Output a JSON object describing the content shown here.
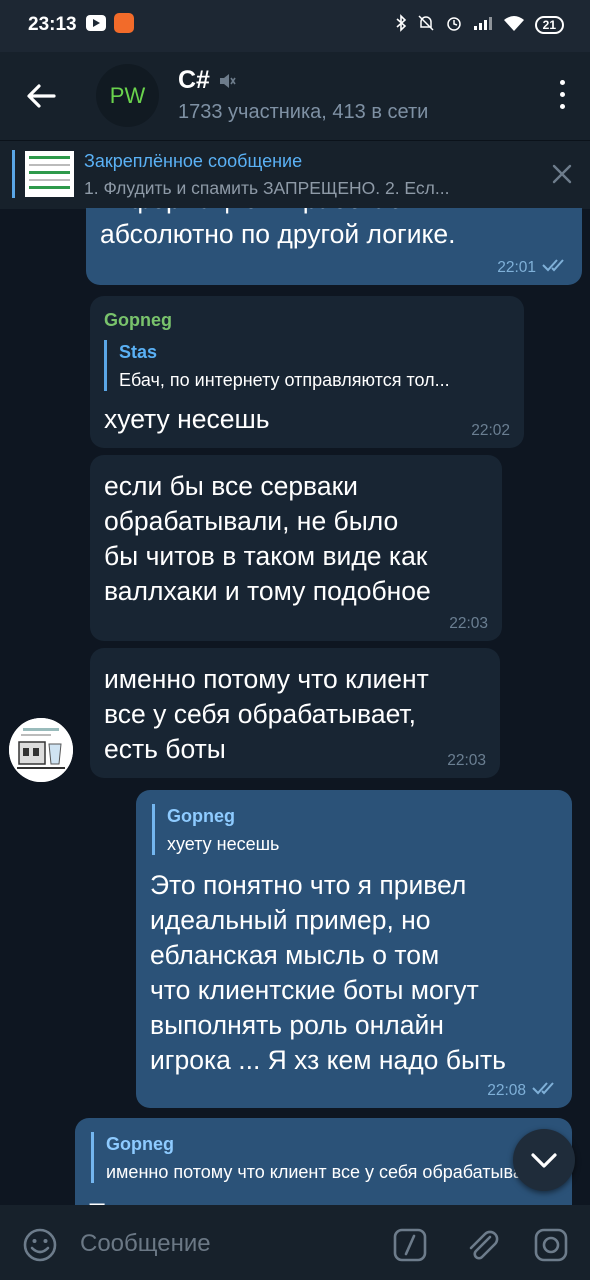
{
  "status_bar": {
    "time": "23:13",
    "battery": "21"
  },
  "header": {
    "avatar_text": "PW",
    "title": "C#",
    "subtitle": "1733 участника, 413 в сети"
  },
  "pinned": {
    "title": "Закреплённое сообщение",
    "text": "1. Флудить и спамить ЗАПРЕЩЕНО.  2. Есл..."
  },
  "messages": [
    {
      "text": "информацией и работает\nабсолютно по другой логике.",
      "time": "22:01"
    },
    {
      "sender": "Gopneg",
      "reply_name": "Stas",
      "reply_text": "Ебач, по интернету отправляются тол...",
      "text": "хуету несешь",
      "time": "22:02"
    },
    {
      "text": "если бы все серваки\nобрабатывали, не было\nбы читов в таком виде как\nваллхаки и тому подобное",
      "time": "22:03"
    },
    {
      "text": "именно потому что клиент\nвсе у себя обрабатывает,\nесть боты",
      "time": "22:03"
    },
    {
      "reply_name": "Gopneg",
      "reply_text": "хуету несешь",
      "text": "Это понятно что я привел\nидеальный пример, но\nебланская мысль о том\nчто клиентские боты могут\nвыполнять роль онлайн\nигрока ... Я хз кем надо быть",
      "time": "22:08"
    },
    {
      "reply_name": "Gopneg",
      "reply_text": "именно потому что клиент все у себя обрабатывает,",
      "text": "Т"
    }
  ],
  "input": {
    "placeholder": "Сообщение"
  },
  "colors": {
    "background": "#0e1621",
    "incoming": "#182533",
    "outgoing": "#2b5278",
    "accent": "#5ab1f5",
    "sender_name": "#79c36c"
  }
}
